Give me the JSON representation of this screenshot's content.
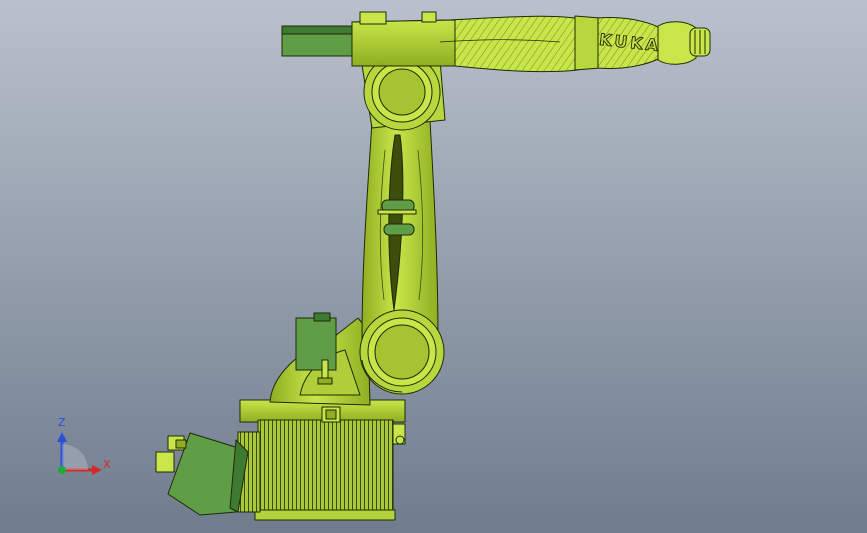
{
  "viewport": {
    "background_top": "#b9c1cc",
    "background_bottom": "#6f7c8d"
  },
  "model": {
    "brand_text": "KUKA",
    "body_color": "#c8e64a",
    "body_shade": "#8fae22",
    "edge_color": "#1f2a05",
    "housing_color": "#5f9e46",
    "housing_shade": "#3e7a32"
  },
  "triad": {
    "z_label": "Z",
    "x_label": "X",
    "z_color": "#2b4fd8",
    "x_color": "#d62828",
    "y_color": "#22a83a"
  }
}
